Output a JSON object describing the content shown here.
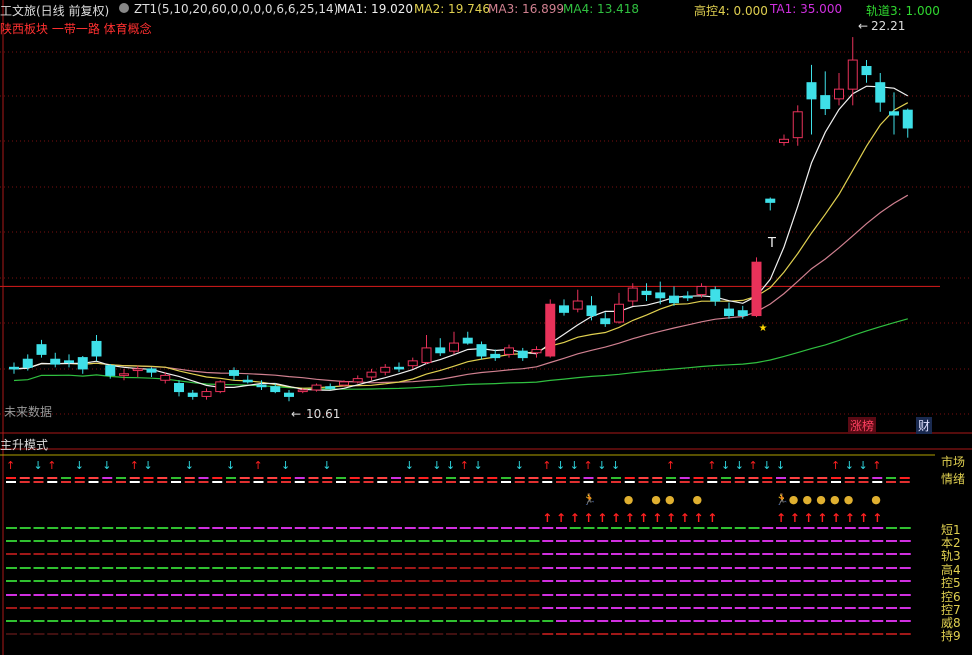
{
  "header": {
    "title": "工文旅(日线 前复权)",
    "formula": "ZT1(5,10,20,60,0,0,0,0,6,6,25,14)",
    "ma1": "MA1: 19.020",
    "ma2": "MA2: 19.746",
    "ma3": "MA3: 16.899",
    "ma4": "MA4: 13.418",
    "gaokong": "高控4: 0.000",
    "ta1": "TA1: 35.000",
    "guidao": "轨道3: 1.000",
    "concepts": "陕西板块 一带一路 体育概念"
  },
  "labels": {
    "high": "22.21",
    "low": "10.61",
    "low_arrow": "←",
    "high_arrow": "←",
    "no_data": "未来数据",
    "t_mark": "T",
    "zhangting": "涨榜",
    "cai": "财",
    "panel_title": "主升模式",
    "shichang": "市场",
    "qingxu": "情绪"
  },
  "right_labels": [
    "短1",
    "本2",
    "轨3",
    "高4",
    "控5",
    "控6",
    "控7",
    "威8",
    "持9"
  ],
  "colors": {
    "bg": "#000000",
    "up": "#e8325a",
    "down": "#3fe0e8",
    "ma1": "#f0f0f0",
    "ma2": "#e0d050",
    "ma3": "#d08090",
    "ma4": "#30c040",
    "grid": "#7a1010",
    "resist": "#c01818",
    "arrow_red": "#ff2020",
    "arrow_cyan": "#30d8e0",
    "magenta": "#d030e0",
    "green": "#30c030",
    "darkred": "#a01818"
  },
  "chart_data": {
    "type": "candlestick",
    "x": [
      1,
      2,
      3,
      4,
      5,
      6,
      7,
      8,
      9,
      10,
      11,
      12,
      13,
      14,
      15,
      16,
      17,
      18,
      19,
      20,
      21,
      22,
      23,
      24,
      25,
      26,
      27,
      28,
      29,
      30,
      31,
      32,
      33,
      34,
      35,
      36,
      37,
      38,
      39,
      40,
      41,
      42,
      43,
      44,
      45,
      46,
      47,
      48,
      49,
      50,
      51,
      52,
      53,
      54,
      55,
      56,
      57,
      58,
      59,
      60,
      61,
      62,
      63,
      64,
      65,
      66
    ],
    "ylim": [
      10.0,
      22.8
    ],
    "ohlc": [
      [
        12.0,
        12.15,
        11.95,
        11.8
      ],
      [
        12.25,
        12.4,
        12.0,
        11.9
      ],
      [
        12.7,
        12.85,
        12.4,
        12.3
      ],
      [
        12.25,
        12.45,
        12.1,
        12.0
      ],
      [
        12.2,
        12.4,
        12.15,
        12.0
      ],
      [
        12.3,
        12.35,
        11.95,
        11.8
      ],
      [
        12.8,
        13.0,
        12.35,
        12.2
      ],
      [
        12.05,
        12.1,
        11.75,
        11.65
      ],
      [
        11.75,
        11.95,
        11.8,
        11.6
      ],
      [
        11.9,
        12.05,
        11.95,
        11.7
      ],
      [
        11.95,
        12.0,
        11.85,
        11.7
      ],
      [
        11.6,
        11.85,
        11.75,
        11.5
      ],
      [
        11.5,
        11.6,
        11.25,
        11.1
      ],
      [
        11.2,
        11.3,
        11.1,
        11.0
      ],
      [
        11.1,
        11.35,
        11.25,
        11.0
      ],
      [
        11.25,
        11.6,
        11.55,
        11.2
      ],
      [
        11.9,
        12.0,
        11.75,
        11.6
      ],
      [
        11.6,
        11.75,
        11.55,
        11.5
      ],
      [
        11.45,
        11.6,
        11.4,
        11.3
      ],
      [
        11.4,
        11.5,
        11.25,
        11.2
      ],
      [
        11.2,
        11.3,
        11.1,
        10.95
      ],
      [
        11.25,
        11.35,
        11.3,
        11.2
      ],
      [
        11.3,
        11.5,
        11.45,
        11.25
      ],
      [
        11.4,
        11.5,
        11.35,
        11.3
      ],
      [
        11.45,
        11.6,
        11.55,
        11.4
      ],
      [
        11.55,
        11.75,
        11.65,
        11.5
      ],
      [
        11.7,
        11.95,
        11.85,
        11.6
      ],
      [
        11.85,
        12.1,
        12.0,
        11.75
      ],
      [
        12.0,
        12.15,
        11.95,
        11.85
      ],
      [
        12.05,
        12.3,
        12.2,
        11.95
      ],
      [
        12.15,
        13.0,
        12.6,
        12.1
      ],
      [
        12.6,
        12.9,
        12.45,
        12.35
      ],
      [
        12.5,
        13.1,
        12.75,
        12.4
      ],
      [
        12.9,
        13.1,
        12.75,
        12.7
      ],
      [
        12.7,
        12.8,
        12.35,
        12.25
      ],
      [
        12.4,
        12.55,
        12.3,
        12.2
      ],
      [
        12.4,
        12.7,
        12.6,
        12.3
      ],
      [
        12.5,
        12.6,
        12.3,
        12.2
      ],
      [
        12.45,
        12.65,
        12.55,
        12.3
      ],
      [
        12.35,
        14.1,
        13.95,
        12.3
      ],
      [
        13.9,
        14.1,
        13.7,
        13.6
      ],
      [
        13.8,
        14.4,
        14.05,
        13.7
      ],
      [
        13.9,
        14.2,
        13.6,
        13.45
      ],
      [
        13.5,
        13.7,
        13.35,
        13.25
      ],
      [
        13.4,
        14.3,
        13.95,
        13.35
      ],
      [
        14.05,
        14.6,
        14.45,
        13.9
      ],
      [
        14.35,
        14.6,
        14.25,
        14.05
      ],
      [
        14.3,
        14.65,
        14.15,
        13.95
      ],
      [
        14.2,
        14.5,
        14.0,
        13.9
      ],
      [
        14.2,
        14.35,
        14.15,
        14.05
      ],
      [
        14.25,
        14.6,
        14.5,
        14.15
      ],
      [
        14.4,
        14.5,
        14.05,
        13.9
      ],
      [
        13.8,
        14.0,
        13.6,
        13.5
      ],
      [
        13.75,
        13.9,
        13.6,
        13.5
      ],
      [
        13.6,
        15.4,
        15.25,
        13.55
      ],
      [
        17.2,
        17.25,
        17.1,
        16.85
      ],
      [
        18.95,
        19.2,
        19.05,
        18.85
      ],
      [
        19.1,
        20.1,
        19.9,
        18.85
      ],
      [
        20.8,
        21.35,
        20.3,
        19.2
      ],
      [
        20.4,
        21.15,
        20.0,
        19.8
      ],
      [
        20.3,
        21.1,
        20.6,
        20.1
      ],
      [
        20.6,
        22.21,
        21.5,
        20.1
      ],
      [
        21.3,
        21.5,
        21.05,
        20.8
      ],
      [
        20.8,
        21.1,
        20.2,
        19.9
      ],
      [
        19.9,
        20.5,
        19.8,
        19.2
      ],
      [
        19.95,
        20.0,
        19.4,
        19.1
      ]
    ],
    "ohlc_order": "open,high,close,low",
    "high_label": 22.21,
    "low_label": 10.61,
    "resistance": 14.5
  }
}
